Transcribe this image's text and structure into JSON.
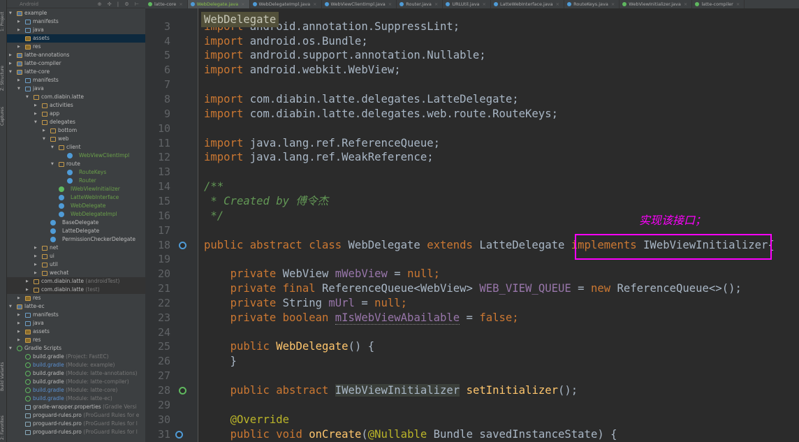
{
  "tool_strip": [
    "1: Project",
    "Z: Structure",
    "Captures",
    "Build Variants",
    "2: Favorites"
  ],
  "project_panel": {
    "view_selector": "Android",
    "tools": "⊕ ✣ | ⚙ ⊢",
    "tree": [
      {
        "lv": 0,
        "open": true,
        "icon": "mod",
        "label": "example"
      },
      {
        "lv": 1,
        "open": false,
        "icon": "src",
        "label": "manifests"
      },
      {
        "lv": 1,
        "open": false,
        "icon": "src",
        "label": "java"
      },
      {
        "lv": 1,
        "icon": "res",
        "label": "assets",
        "selected": true
      },
      {
        "lv": 1,
        "open": false,
        "icon": "res",
        "label": "res"
      },
      {
        "lv": 0,
        "open": false,
        "icon": "mod",
        "label": "latte-annotations"
      },
      {
        "lv": 0,
        "open": false,
        "icon": "mod",
        "label": "latte-compiler"
      },
      {
        "lv": 0,
        "open": true,
        "icon": "mod",
        "label": "latte-core"
      },
      {
        "lv": 1,
        "open": false,
        "icon": "src",
        "label": "manifests"
      },
      {
        "lv": 1,
        "open": true,
        "icon": "src",
        "label": "java"
      },
      {
        "lv": 2,
        "open": true,
        "icon": "pkg",
        "label": "com.diabin.latte"
      },
      {
        "lv": 3,
        "open": false,
        "icon": "pkg",
        "label": "activities"
      },
      {
        "lv": 3,
        "open": false,
        "icon": "pkg",
        "label": "app"
      },
      {
        "lv": 3,
        "open": true,
        "icon": "pkg",
        "label": "delegates"
      },
      {
        "lv": 4,
        "open": false,
        "icon": "pkg",
        "label": "bottom"
      },
      {
        "lv": 4,
        "open": true,
        "icon": "pkg",
        "label": "web"
      },
      {
        "lv": 5,
        "open": true,
        "icon": "pkg",
        "label": "client"
      },
      {
        "lv": 6,
        "icon": "cls",
        "label": "WebViewClientImpl",
        "color": "#6a9f4a"
      },
      {
        "lv": 5,
        "open": true,
        "icon": "pkg",
        "label": "route"
      },
      {
        "lv": 6,
        "icon": "cls",
        "label": "RouteKeys",
        "color": "#6a9f4a"
      },
      {
        "lv": 6,
        "icon": "cls",
        "label": "Router",
        "color": "#6a9f4a"
      },
      {
        "lv": 5,
        "icon": "ifc",
        "label": "IWebViewInitializer",
        "color": "#6a9f4a"
      },
      {
        "lv": 5,
        "icon": "cls",
        "label": "LatteWebInterface",
        "color": "#6a9f4a"
      },
      {
        "lv": 5,
        "icon": "cls",
        "label": "WebDelegate",
        "color": "#6a9f4a"
      },
      {
        "lv": 5,
        "icon": "cls",
        "label": "WebDelegateImpl",
        "color": "#6a9f4a"
      },
      {
        "lv": 4,
        "icon": "cls",
        "label": "BaseDelegate"
      },
      {
        "lv": 4,
        "icon": "cls",
        "label": "LatteDelegate"
      },
      {
        "lv": 4,
        "icon": "cls",
        "label": "PermissionCheckerDelegate"
      },
      {
        "lv": 3,
        "open": false,
        "icon": "pkg",
        "label": "net"
      },
      {
        "lv": 3,
        "open": false,
        "icon": "pkg",
        "label": "ui"
      },
      {
        "lv": 3,
        "open": false,
        "icon": "pkg",
        "label": "util"
      },
      {
        "lv": 3,
        "open": false,
        "icon": "pkg",
        "label": "wechat"
      },
      {
        "lv": 2,
        "open": false,
        "icon": "pkg",
        "label": "com.diabin.latte",
        "suffix": "(androidTest)",
        "band": true
      },
      {
        "lv": 2,
        "open": false,
        "icon": "pkg",
        "label": "com.diabin.latte",
        "suffix": "(test)",
        "band": true
      },
      {
        "lv": 1,
        "open": false,
        "icon": "res",
        "label": "res"
      },
      {
        "lv": 0,
        "open": true,
        "icon": "mod",
        "label": "latte-ec"
      },
      {
        "lv": 1,
        "open": false,
        "icon": "src",
        "label": "manifests"
      },
      {
        "lv": 1,
        "open": false,
        "icon": "src",
        "label": "java"
      },
      {
        "lv": 1,
        "open": false,
        "icon": "res",
        "label": "assets"
      },
      {
        "lv": 1,
        "open": false,
        "icon": "res",
        "label": "res"
      },
      {
        "lv": 0,
        "open": true,
        "icon": "grd",
        "label": "Gradle Scripts"
      },
      {
        "lv": 1,
        "icon": "grd",
        "label": "build.gradle",
        "suffix": "(Project: FastEC)"
      },
      {
        "lv": 1,
        "icon": "grd",
        "label": "build.gradle",
        "suffix": "(Module: example)",
        "color": "#5a8fd0"
      },
      {
        "lv": 1,
        "icon": "grd",
        "label": "build.gradle",
        "suffix": "(Module: latte-annotations)"
      },
      {
        "lv": 1,
        "icon": "grd",
        "label": "build.gradle",
        "suffix": "(Module: latte-compiler)"
      },
      {
        "lv": 1,
        "icon": "grd",
        "label": "build.gradle",
        "suffix": "(Module: latte-core)",
        "color": "#5a8fd0"
      },
      {
        "lv": 1,
        "icon": "grd",
        "label": "build.gradle",
        "suffix": "(Module: latte-ec)",
        "color": "#5a8fd0"
      },
      {
        "lv": 1,
        "icon": "file",
        "label": "gradle-wrapper.properties",
        "suffix": "(Gradle Versi"
      },
      {
        "lv": 1,
        "icon": "file",
        "label": "proguard-rules.pro",
        "suffix": "(ProGuard Rules for e"
      },
      {
        "lv": 1,
        "icon": "file",
        "label": "proguard-rules.pro",
        "suffix": "(ProGuard Rules for l"
      },
      {
        "lv": 1,
        "icon": "file",
        "label": "proguard-rules.pro",
        "suffix": "(ProGuard Rules for l"
      }
    ]
  },
  "tabs": [
    {
      "label": "latte-core"
    },
    {
      "label": "WebDelegate.java",
      "active": true
    },
    {
      "label": "WebDelegateImpl.java"
    },
    {
      "label": "WebViewClientImpl.java"
    },
    {
      "label": "Router.java"
    },
    {
      "label": "URLUtil.java"
    },
    {
      "label": "LatteWebInterface.java"
    },
    {
      "label": "RouteKeys.java"
    },
    {
      "label": "WebViewInitializer.java"
    },
    {
      "label": "latte-compiler"
    }
  ],
  "popup": "WebDelegate",
  "code": [
    {
      "n": 3,
      "t": [
        [
          "k",
          "import "
        ],
        [
          "",
          "android.annotation.SuppressLint;"
        ]
      ]
    },
    {
      "n": 4,
      "t": [
        [
          "k",
          "import "
        ],
        [
          "",
          "android.os.Bundle;"
        ]
      ]
    },
    {
      "n": 5,
      "t": [
        [
          "k",
          "import "
        ],
        [
          "",
          "android.support.annotation.Nullable;"
        ]
      ]
    },
    {
      "n": 6,
      "t": [
        [
          "k",
          "import "
        ],
        [
          "",
          "android.webkit.WebView;"
        ]
      ]
    },
    {
      "n": 7,
      "t": []
    },
    {
      "n": 8,
      "t": [
        [
          "k",
          "import "
        ],
        [
          "",
          "com.diabin.latte.delegates.LatteDelegate;"
        ]
      ]
    },
    {
      "n": 9,
      "t": [
        [
          "k",
          "import "
        ],
        [
          "",
          "com.diabin.latte.delegates.web.route.RouteKeys;"
        ]
      ]
    },
    {
      "n": 10,
      "t": []
    },
    {
      "n": 11,
      "t": [
        [
          "k",
          "import "
        ],
        [
          "",
          "java.lang.ref.ReferenceQueue;"
        ]
      ]
    },
    {
      "n": 12,
      "t": [
        [
          "k",
          "import "
        ],
        [
          "",
          "java.lang.ref.WeakReference;"
        ]
      ]
    },
    {
      "n": 13,
      "t": []
    },
    {
      "n": 14,
      "t": [
        [
          "c",
          "/**"
        ]
      ]
    },
    {
      "n": 15,
      "t": [
        [
          "c",
          " * Created by 傅令杰"
        ]
      ]
    },
    {
      "n": 16,
      "t": [
        [
          "c",
          " */"
        ]
      ]
    },
    {
      "n": 17,
      "t": []
    },
    {
      "n": 18,
      "t": [
        [
          "k",
          "public abstract class "
        ],
        [
          "",
          "WebDelegate "
        ],
        [
          "k",
          "extends "
        ],
        [
          "",
          "LatteDelegate "
        ],
        [
          "k",
          "implements "
        ],
        [
          "",
          "IWebViewInitializer{"
        ]
      ]
    },
    {
      "n": 19,
      "t": []
    },
    {
      "n": 20,
      "t": [
        [
          "",
          "    "
        ],
        [
          "k",
          "private "
        ],
        [
          "",
          "WebView "
        ],
        [
          "f",
          "mWebView"
        ],
        [
          "",
          " = "
        ],
        [
          "k",
          "null;"
        ]
      ]
    },
    {
      "n": 21,
      "t": [
        [
          "",
          "    "
        ],
        [
          "k",
          "private final "
        ],
        [
          "",
          "ReferenceQueue<WebView> "
        ],
        [
          "f",
          "WEB_VIEW_QUEUE"
        ],
        [
          "",
          " = "
        ],
        [
          "k",
          "new "
        ],
        [
          "",
          "ReferenceQueue<>();"
        ]
      ]
    },
    {
      "n": 22,
      "t": [
        [
          "",
          "    "
        ],
        [
          "k",
          "private "
        ],
        [
          "",
          "String "
        ],
        [
          "f",
          "mUrl"
        ],
        [
          "",
          " = "
        ],
        [
          "k",
          "null;"
        ]
      ]
    },
    {
      "n": 23,
      "t": [
        [
          "",
          "    "
        ],
        [
          "k",
          "private boolean "
        ],
        [
          "fu",
          "mIsWebViewAbailable"
        ],
        [
          "",
          " = "
        ],
        [
          "k",
          "false;"
        ]
      ]
    },
    {
      "n": 24,
      "t": []
    },
    {
      "n": 25,
      "t": [
        [
          "",
          "    "
        ],
        [
          "k",
          "public "
        ],
        [
          "m",
          "WebDelegate"
        ],
        [
          "",
          "() {"
        ]
      ]
    },
    {
      "n": 26,
      "t": [
        [
          "",
          "    }"
        ]
      ]
    },
    {
      "n": 27,
      "t": []
    },
    {
      "n": 28,
      "t": [
        [
          "",
          "    "
        ],
        [
          "k",
          "public abstract "
        ],
        [
          "hl",
          "IWebViewInitializer"
        ],
        [
          "",
          " "
        ],
        [
          "m",
          "setInitializer"
        ],
        [
          "",
          "();"
        ]
      ]
    },
    {
      "n": 29,
      "t": []
    },
    {
      "n": 30,
      "t": [
        [
          "",
          "    "
        ],
        [
          "a",
          "@Override"
        ]
      ]
    },
    {
      "n": 31,
      "t": [
        [
          "",
          "    "
        ],
        [
          "k",
          "public void "
        ],
        [
          "m",
          "onCreate"
        ],
        [
          "",
          "("
        ],
        [
          "a",
          "@Nullable "
        ],
        [
          "",
          "Bundle savedInstanceState) {"
        ]
      ]
    }
  ],
  "annotation": {
    "text": "实现该接口；",
    "color": "#ff00ff"
  },
  "colors": {
    "keyword": "#cc7832",
    "field": "#9876aa",
    "comment": "#629755",
    "text": "#a9b7c6",
    "background": "#2b2b2b"
  }
}
